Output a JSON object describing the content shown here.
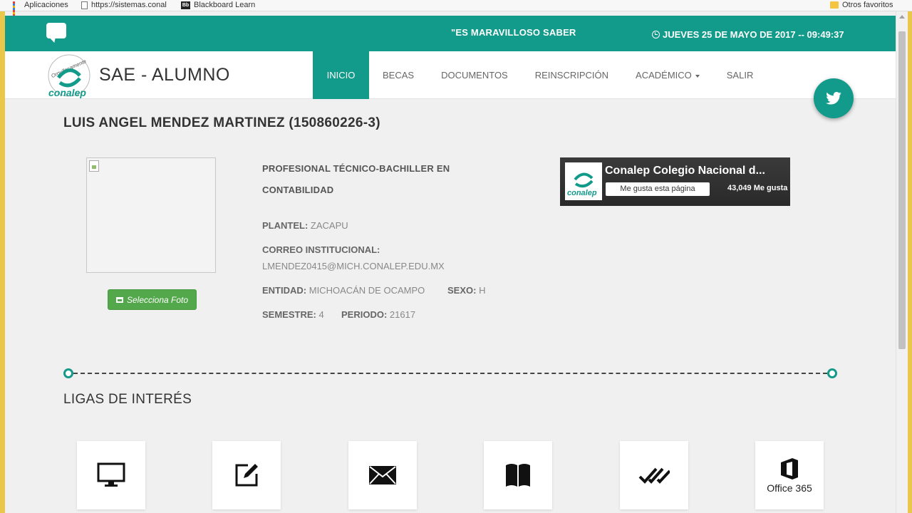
{
  "bookmarks": [
    {
      "label": "Aplicaciones",
      "icon": "apps-icon"
    },
    {
      "label": "https://sistemas.conal",
      "icon": "page-icon"
    },
    {
      "label": "Blackboard Learn",
      "icon": "blackboard-icon"
    }
  ],
  "bookmarks_right": {
    "label": "Otros favoritos",
    "icon": "folder-icon"
  },
  "topbar": {
    "motto": "\"ES MARAVILLOSO SABER",
    "datetime": "JUEVES 25 DE MAYO DE 2017 -- 09:49:37"
  },
  "logo": {
    "top_text": "Orgullosamente",
    "brand_text": "conalep"
  },
  "brand": "SAE - ALUMNO",
  "nav": [
    {
      "label": "INICIO",
      "active": true
    },
    {
      "label": "BECAS"
    },
    {
      "label": "DOCUMENTOS"
    },
    {
      "label": "REINSCRIPCIÓN"
    },
    {
      "label": "ACADÉMICO",
      "dropdown": true
    },
    {
      "label": "SALIR"
    }
  ],
  "student": {
    "name": "LUIS ANGEL MENDEZ MARTINEZ (150860226-3)",
    "career": "PROFESIONAL TÉCNICO-BACHILLER EN CONTABILIDAD",
    "plantel_label": "PLANTEL:",
    "plantel": "ZACAPU",
    "email_label": "CORREO INSTITUCIONAL:",
    "email": "LMENDEZ0415@MICH.CONALEP.EDU.MX",
    "entidad_label": "ENTIDAD:",
    "entidad": "MICHOACÁN DE OCAMPO",
    "sexo_label": "SEXO:",
    "sexo": "H",
    "semestre_label": "SEMESTRE:",
    "semestre": "4",
    "periodo_label": "PERIODO:",
    "periodo": "21617",
    "photo_button": "Selecciona Foto"
  },
  "facebook": {
    "title": "Conalep Colegio Nacional d...",
    "like_button": "Me gusta esta página",
    "count": "43,049 Me gusta",
    "logo_text": "conalep"
  },
  "links_title": "LIGAS DE INTERÉS",
  "link_cards": [
    {
      "icon": "monitor-icon"
    },
    {
      "icon": "edit-icon"
    },
    {
      "icon": "mail-icon"
    },
    {
      "icon": "book-icon"
    },
    {
      "icon": "double-check-icon"
    },
    {
      "icon": "office365-icon",
      "label": "Office 365"
    }
  ],
  "colors": {
    "primary": "#129a8a",
    "photo_button": "#52a84a",
    "facebook_bg": "#2f2f2f"
  }
}
